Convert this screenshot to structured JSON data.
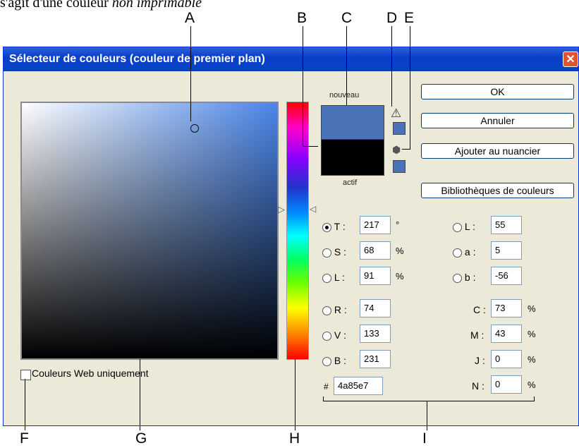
{
  "caption": {
    "prefix": "s'agit d'une couleur ",
    "emph": "non imprimable"
  },
  "callouts": {
    "A": "A",
    "B": "B",
    "C": "C",
    "D": "D",
    "E": "E",
    "F": "F",
    "G": "G",
    "H": "H",
    "I": "I"
  },
  "dialog": {
    "title": "Sélecteur de couleurs (couleur de premier plan)",
    "close_glyph": "✕",
    "label_new": "nouveau",
    "label_current": "actif",
    "buttons": {
      "ok": "OK",
      "cancel": "Annuler",
      "add_swatch": "Ajouter au nuancier",
      "libraries": "Bibliothèques de couleurs"
    },
    "hsb": [
      {
        "label": "T :",
        "value": "217",
        "unit": "°",
        "selected": true
      },
      {
        "label": "S :",
        "value": "68",
        "unit": "%",
        "selected": false
      },
      {
        "label": "L :",
        "value": "91",
        "unit": "%",
        "selected": false
      }
    ],
    "rgb": [
      {
        "label": "R :",
        "value": "74"
      },
      {
        "label": "V :",
        "value": "133"
      },
      {
        "label": "B :",
        "value": "231"
      }
    ],
    "lab": [
      {
        "label": "L :",
        "value": "55"
      },
      {
        "label": "a :",
        "value": "5"
      },
      {
        "label": "b :",
        "value": "-56"
      }
    ],
    "cmyk": [
      {
        "label": "C :",
        "value": "73",
        "unit": "%"
      },
      {
        "label": "M :",
        "value": "43",
        "unit": "%"
      },
      {
        "label": "J :",
        "value": "0",
        "unit": "%"
      },
      {
        "label": "N :",
        "value": "0",
        "unit": "%"
      }
    ],
    "hex": {
      "label": "#",
      "value": "4a85e7"
    },
    "web_only_label": "Couleurs Web uniquement",
    "colors": {
      "new_swatch": "#4a73b7",
      "current_swatch": "#000000",
      "picked": "#4a85e7"
    }
  }
}
